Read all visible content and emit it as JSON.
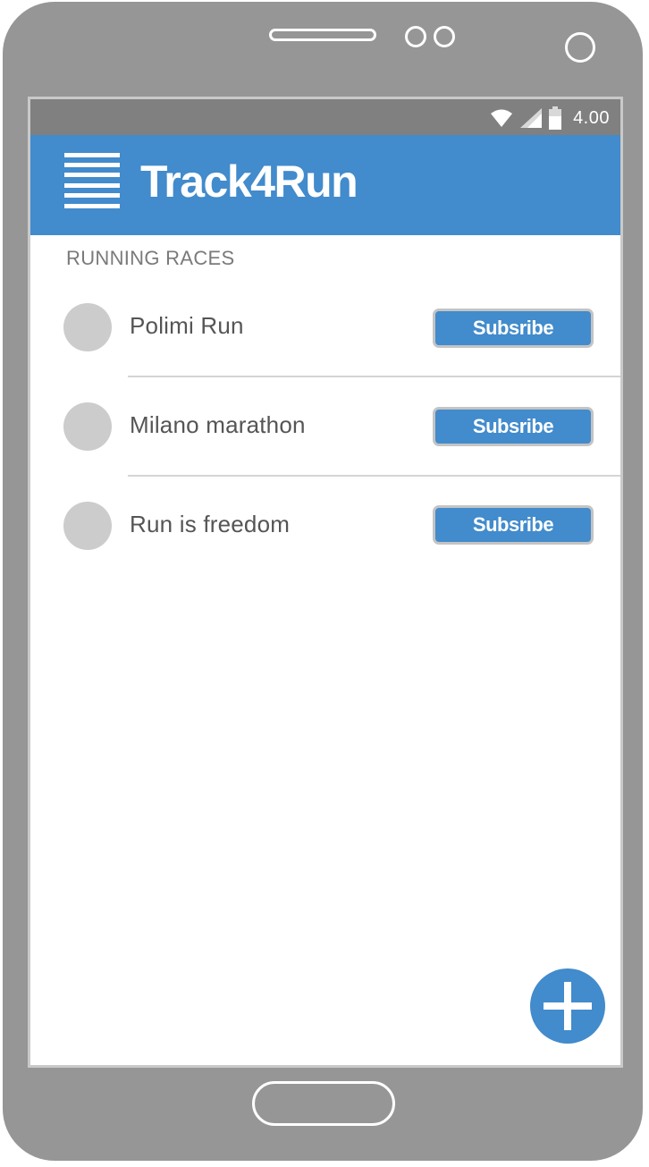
{
  "status_bar": {
    "time": "4.00",
    "icons": [
      "wifi-icon",
      "signal-icon",
      "battery-icon"
    ]
  },
  "app_bar": {
    "title": "Track4Run",
    "menu_icon": "hamburger-menu-icon"
  },
  "section": {
    "header": "RUNNING RACES"
  },
  "races": [
    {
      "name": "Polimi Run",
      "button_label": "Subsribe"
    },
    {
      "name": "Milano marathon",
      "button_label": "Subsribe"
    },
    {
      "name": "Run is freedom",
      "button_label": "Subsribe"
    }
  ],
  "fab": {
    "icon": "plus-icon"
  },
  "colors": {
    "primary": "#428bcc",
    "device_frame": "#969696",
    "status_bar": "#808080",
    "avatar_placeholder": "#cccccc",
    "text_primary": "#555555",
    "text_secondary": "#7a7a7a"
  }
}
